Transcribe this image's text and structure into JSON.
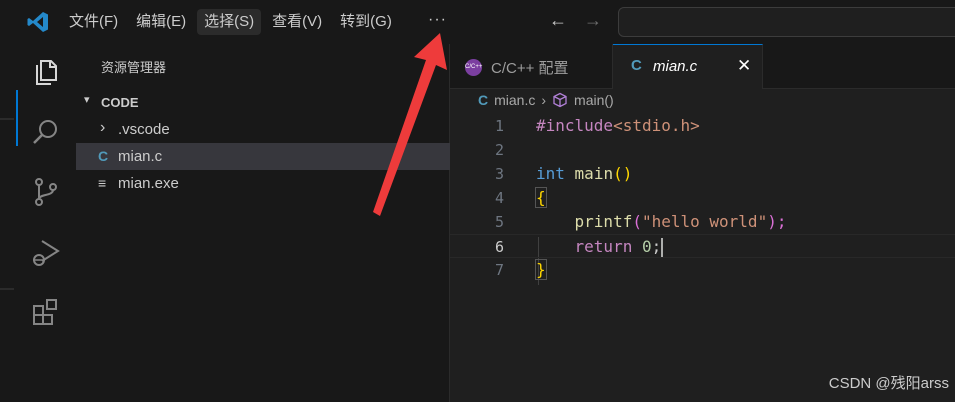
{
  "menu": {
    "items": [
      "文件(F)",
      "编辑(E)",
      "选择(S)",
      "查看(V)",
      "转到(G)"
    ],
    "more": "···"
  },
  "nav": {
    "back": "←",
    "forward": "→"
  },
  "sidebar": {
    "title": "资源管理器",
    "folder": "CODE",
    "files": [
      {
        "icon": "›",
        "name": ".vscode"
      },
      {
        "icon": "C",
        "name": "mian.c"
      },
      {
        "icon": "≡",
        "name": "mian.exe"
      }
    ]
  },
  "tabs": [
    {
      "label": "C/C++ 配置",
      "badge": "C/C++"
    },
    {
      "label": "mian.c",
      "icon": "C",
      "close": "✕"
    }
  ],
  "breadcrumbs": {
    "file_icon": "C",
    "file": "mian.c",
    "sep": "›",
    "symbol": "main()"
  },
  "code": {
    "lines": [
      "1",
      "2",
      "3",
      "4",
      "5",
      "6",
      "7"
    ],
    "include_kw": "#include",
    "include_target": "<stdio.h>",
    "int_kw": "int",
    "main_fn": "main",
    "parens": "()",
    "open_brace": "{",
    "printf_fn": "printf",
    "printf_open": "(",
    "printf_str": "\"hello world\"",
    "printf_close": ");",
    "return_kw": "return",
    "return_val": "0",
    "semi": ";",
    "close_brace": "}"
  },
  "colors": {
    "accent": "#0078d4",
    "keyword": "#569cd6",
    "function": "#dcdcaa",
    "string": "#ce9178",
    "number": "#b5cea8",
    "control": "#c586c0",
    "bracket": "#ffd700",
    "arrow": "#f03c3c"
  },
  "watermark": "CSDN @残阳arss"
}
